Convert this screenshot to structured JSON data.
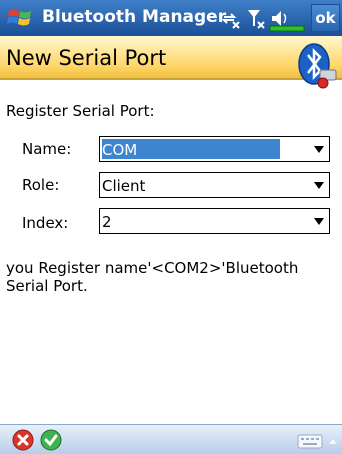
{
  "titlebar": {
    "app_title": "Bluetooth Manager",
    "ok_label": "ok",
    "icons": [
      "windows-start-icon",
      "connectivity-icon",
      "signal-icon",
      "volume-icon",
      "battery-icon"
    ]
  },
  "header": {
    "page_title": "New Serial Port",
    "icon": "bluetooth-icon"
  },
  "form": {
    "section_label": "Register Serial Port:",
    "name": {
      "label": "Name:",
      "value": "COM"
    },
    "role": {
      "label": "Role:",
      "value": "Client"
    },
    "index": {
      "label": "Index:",
      "value": "2"
    }
  },
  "message": "you Register  name'<COM2>'Bluetooth Serial Port.",
  "bottombar": {
    "icons": [
      "cancel-icon",
      "confirm-icon",
      "keyboard-icon"
    ]
  },
  "colors": {
    "titlebar": "#1b4f97",
    "header": "#ffd76a",
    "selection": "#3d86cf",
    "bottombar": "#b9cde8"
  }
}
